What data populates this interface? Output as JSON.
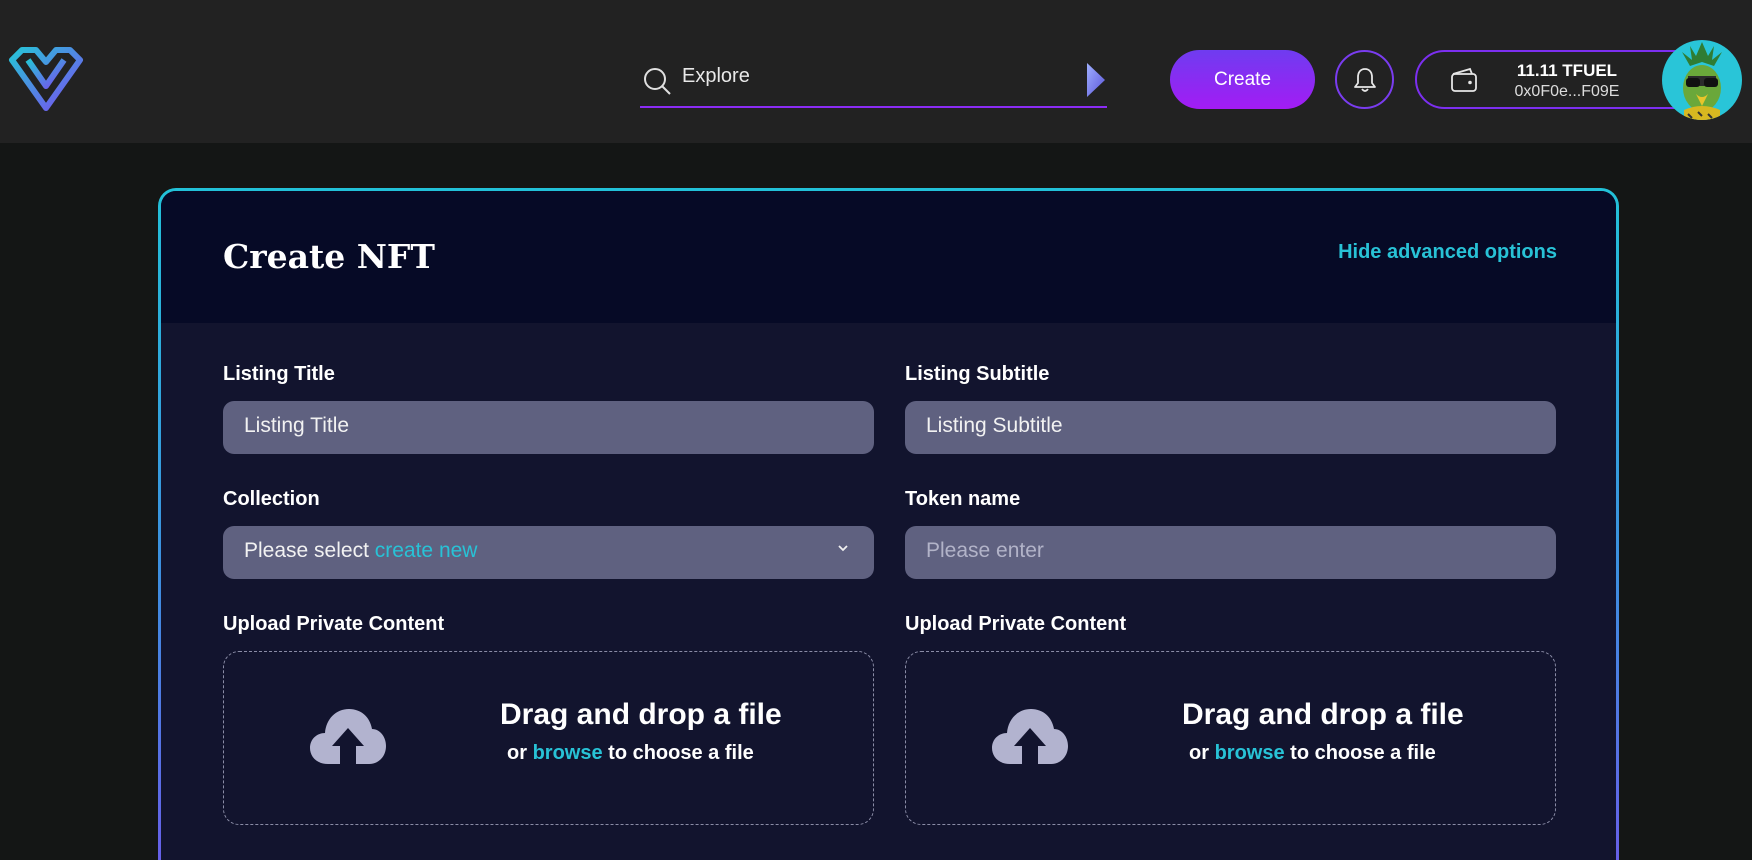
{
  "header": {
    "search": {
      "placeholder": "Explore"
    },
    "create_label": "Create",
    "wallet": {
      "balance": "11.11 TFUEL",
      "address": "0x0F0e...F09E"
    }
  },
  "form": {
    "title": "Create NFT",
    "advanced_link": "Hide advanced options",
    "listing_title": {
      "label": "Listing Title",
      "value": "Listing Title"
    },
    "listing_subtitle": {
      "label": "Listing Subtitle",
      "value": "Listing Subtitle"
    },
    "collection": {
      "label": "Collection",
      "value": "Please select",
      "link": "create new"
    },
    "token_name": {
      "label": "Token name",
      "placeholder": "Please enter"
    },
    "uploads": [
      {
        "label": "Upload Private Content",
        "title": "Drag and drop a file",
        "sub_prefix": "or",
        "sub_link": "browse",
        "sub_suffix": "to choose a file"
      },
      {
        "label": "Upload Private Content",
        "title": "Drag and drop a file",
        "sub_prefix": "or",
        "sub_link": "browse",
        "sub_suffix": "to choose a file"
      }
    ]
  },
  "colors": {
    "accent": "#28c2d6",
    "brand_purple": "#8b2cf5",
    "card_bg": "#12142e",
    "input_bg": "#5f6180"
  },
  "icons": [
    "logo-icon",
    "search-icon",
    "send-icon",
    "bell-icon",
    "wallet-icon",
    "avatar",
    "chevron-down-icon",
    "cloud-upload-icon"
  ]
}
